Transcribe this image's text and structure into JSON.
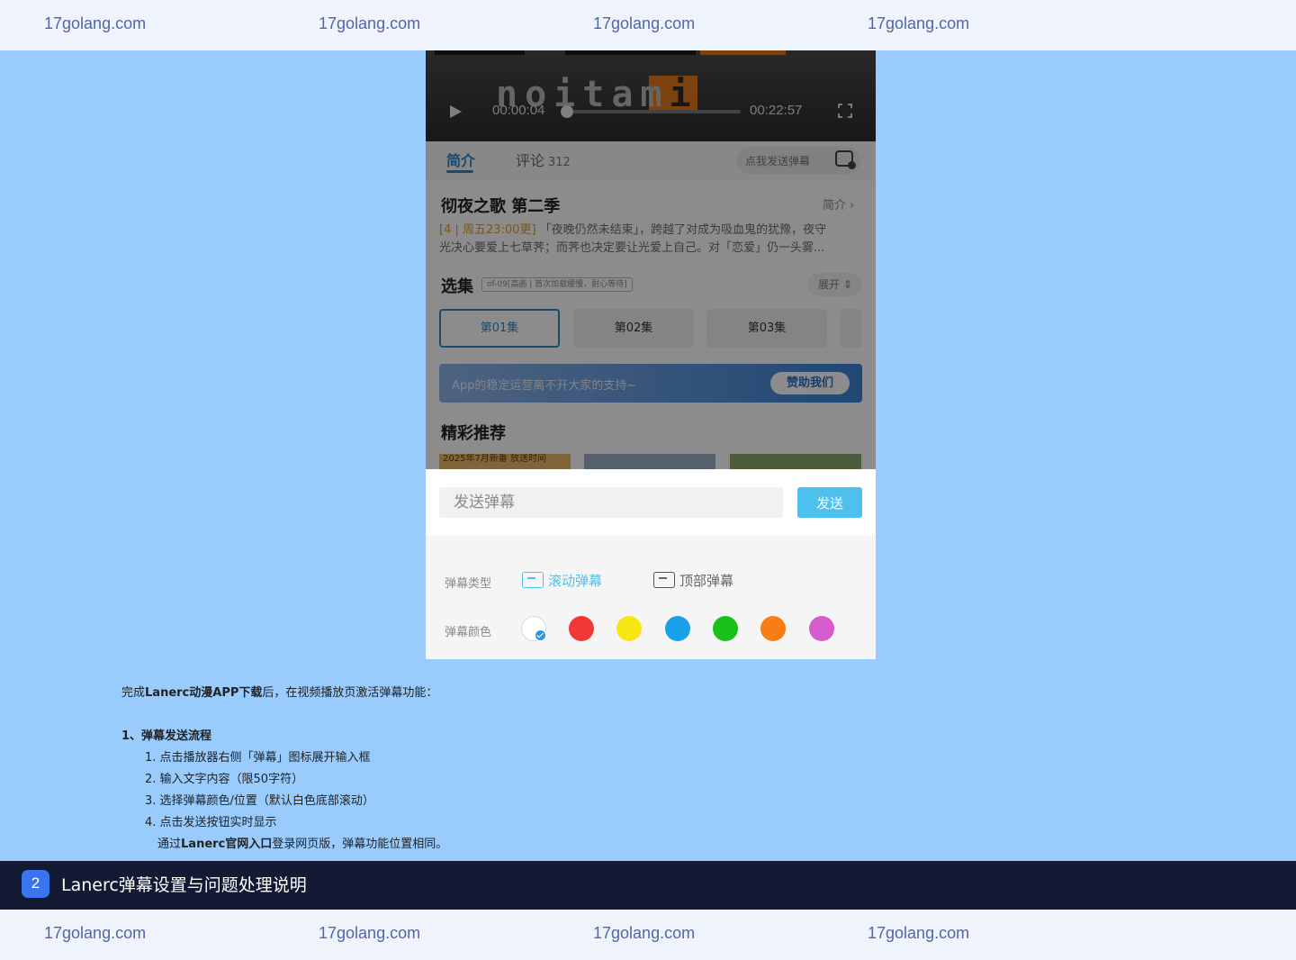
{
  "watermark": {
    "text": "17golang.com"
  },
  "player": {
    "logo_text": "noitam",
    "logo_letter": "i",
    "current_time": "00:00:04",
    "total_time": "00:22:57",
    "progress": 0.0
  },
  "tabs": {
    "intro": "简介",
    "comment": "评论",
    "comment_count": "312",
    "send_prompt": "点我发送弹幕"
  },
  "anime": {
    "title": "彻夜之歌 第二季",
    "intro_link": "简介 ›",
    "update_tag": "[4 | 周五23:00更]",
    "desc_line1": "「夜晚仍然未结束」，跨越了对成为吸血鬼的犹豫，夜守",
    "desc_line2": "光决心要爱上七草荠；而荠也决定要让光爱上自己。对「恋爱」仍一头雾..."
  },
  "episodes": {
    "title": "选集",
    "tag": "of-09[高画 | 首次加载缓慢，耐心等待]",
    "expand": "展开 ⇕",
    "items": [
      "第01集",
      "第02集",
      "第03集"
    ]
  },
  "banner": {
    "text": "App的稳定运营离不开大家的支持~",
    "button": "赞助我们"
  },
  "recommend": {
    "title": "精彩推荐",
    "thumb_caption": "2025年7月新番 放送时间"
  },
  "danmaku": {
    "placeholder": "发送弹幕",
    "send": "发送",
    "type_label": "弹幕类型",
    "type_scroll": "滚动弹幕",
    "type_top": "顶部弹幕",
    "color_label": "弹幕颜色",
    "colors": [
      "#ffffff",
      "#f23737",
      "#f7e614",
      "#1aa0e8",
      "#19c21b",
      "#f77d14",
      "#d65dcc"
    ]
  },
  "article": {
    "intro_pre": "完成",
    "intro_bold": "Lanerc动漫APP下载",
    "intro_post": "后，在视频播放页激活弹幕功能：",
    "section_title": "1、弹幕发送流程",
    "steps": [
      "1. 点击播放器右侧「弹幕」图标展开输入框",
      "2. 输入文字内容（限50字符）",
      "3. 选择弹幕颜色/位置（默认白色底部滚动）",
      "4. 点击发送按钮实时显示"
    ],
    "note_pre": "通过",
    "note_bold": "Lanerc官网入口",
    "note_post": "登录网页版，弹幕功能位置相同。"
  },
  "section": {
    "number": "2",
    "title": "Lanerc弹幕设置与问题处理说明"
  }
}
